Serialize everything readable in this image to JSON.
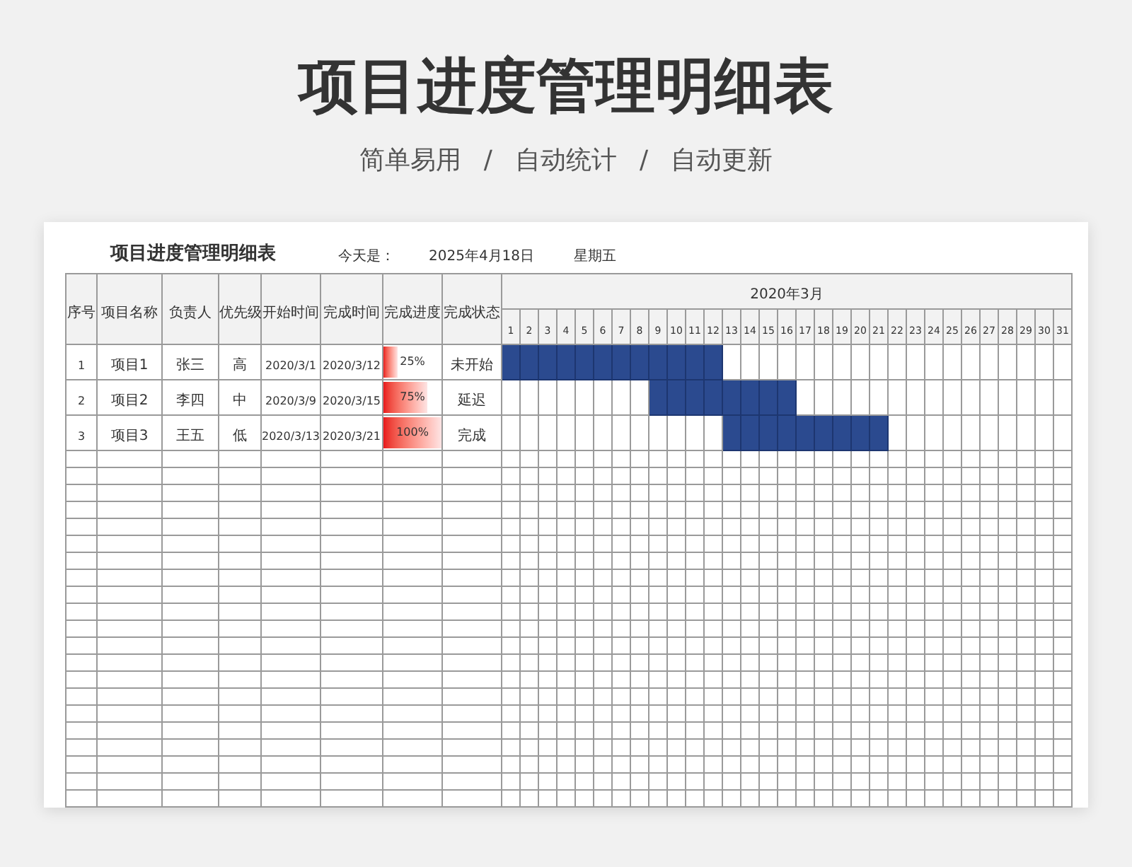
{
  "title": "项目进度管理明细表",
  "subtitle": {
    "items": [
      "简单易用",
      "自动统计",
      "自动更新"
    ],
    "separator": "/"
  },
  "sheet": {
    "title": "项目进度管理明细表",
    "today_label": "今天是：",
    "today_date": "2025年4月18日",
    "weekday": "星期五",
    "columns": [
      "序号",
      "项目名称",
      "负责人",
      "优先级",
      "开始时间",
      "完成时间",
      "完成进度",
      "完成状态"
    ],
    "month": "2020年3月",
    "days": [
      "1",
      "2",
      "3",
      "4",
      "5",
      "6",
      "7",
      "8",
      "9",
      "10",
      "11",
      "12",
      "13",
      "14",
      "15",
      "16",
      "17",
      "18",
      "19",
      "20",
      "21",
      "22",
      "23",
      "24",
      "25",
      "26",
      "27",
      "28",
      "29",
      "30",
      "31"
    ],
    "rows": [
      {
        "no": "1",
        "name": "项目1",
        "owner": "张三",
        "priority": "高",
        "start": "2020/3/1",
        "end": "2020/3/12",
        "level": 0.25,
        "progress": "25%",
        "status": "未开始",
        "gantt": [
          true,
          true,
          true,
          true,
          true,
          true,
          true,
          true,
          true,
          true,
          true,
          true,
          false,
          false,
          false,
          false,
          false,
          false,
          false,
          false,
          false,
          false,
          false,
          false,
          false,
          false,
          false,
          false,
          false,
          false,
          false
        ]
      },
      {
        "no": "2",
        "name": "项目2",
        "owner": "李四",
        "priority": "中",
        "start": "2020/3/9",
        "end": "2020/3/15",
        "level": 0.75,
        "progress": "75%",
        "status": "延迟",
        "gantt": [
          false,
          false,
          false,
          false,
          false,
          false,
          false,
          false,
          true,
          true,
          true,
          true,
          true,
          true,
          true,
          true,
          false,
          false,
          false,
          false,
          false,
          false,
          false,
          false,
          false,
          false,
          false,
          false,
          false,
          false,
          false
        ]
      },
      {
        "no": "3",
        "name": "项目3",
        "owner": "王五",
        "priority": "低",
        "start": "2020/3/13",
        "end": "2020/3/21",
        "level": 1,
        "progress": "100%",
        "status": "完成",
        "gantt": [
          false,
          false,
          false,
          false,
          false,
          false,
          false,
          false,
          false,
          false,
          false,
          false,
          true,
          true,
          true,
          true,
          true,
          true,
          true,
          true,
          true,
          false,
          false,
          false,
          false,
          false,
          false,
          false,
          false,
          false,
          false
        ]
      }
    ]
  }
}
